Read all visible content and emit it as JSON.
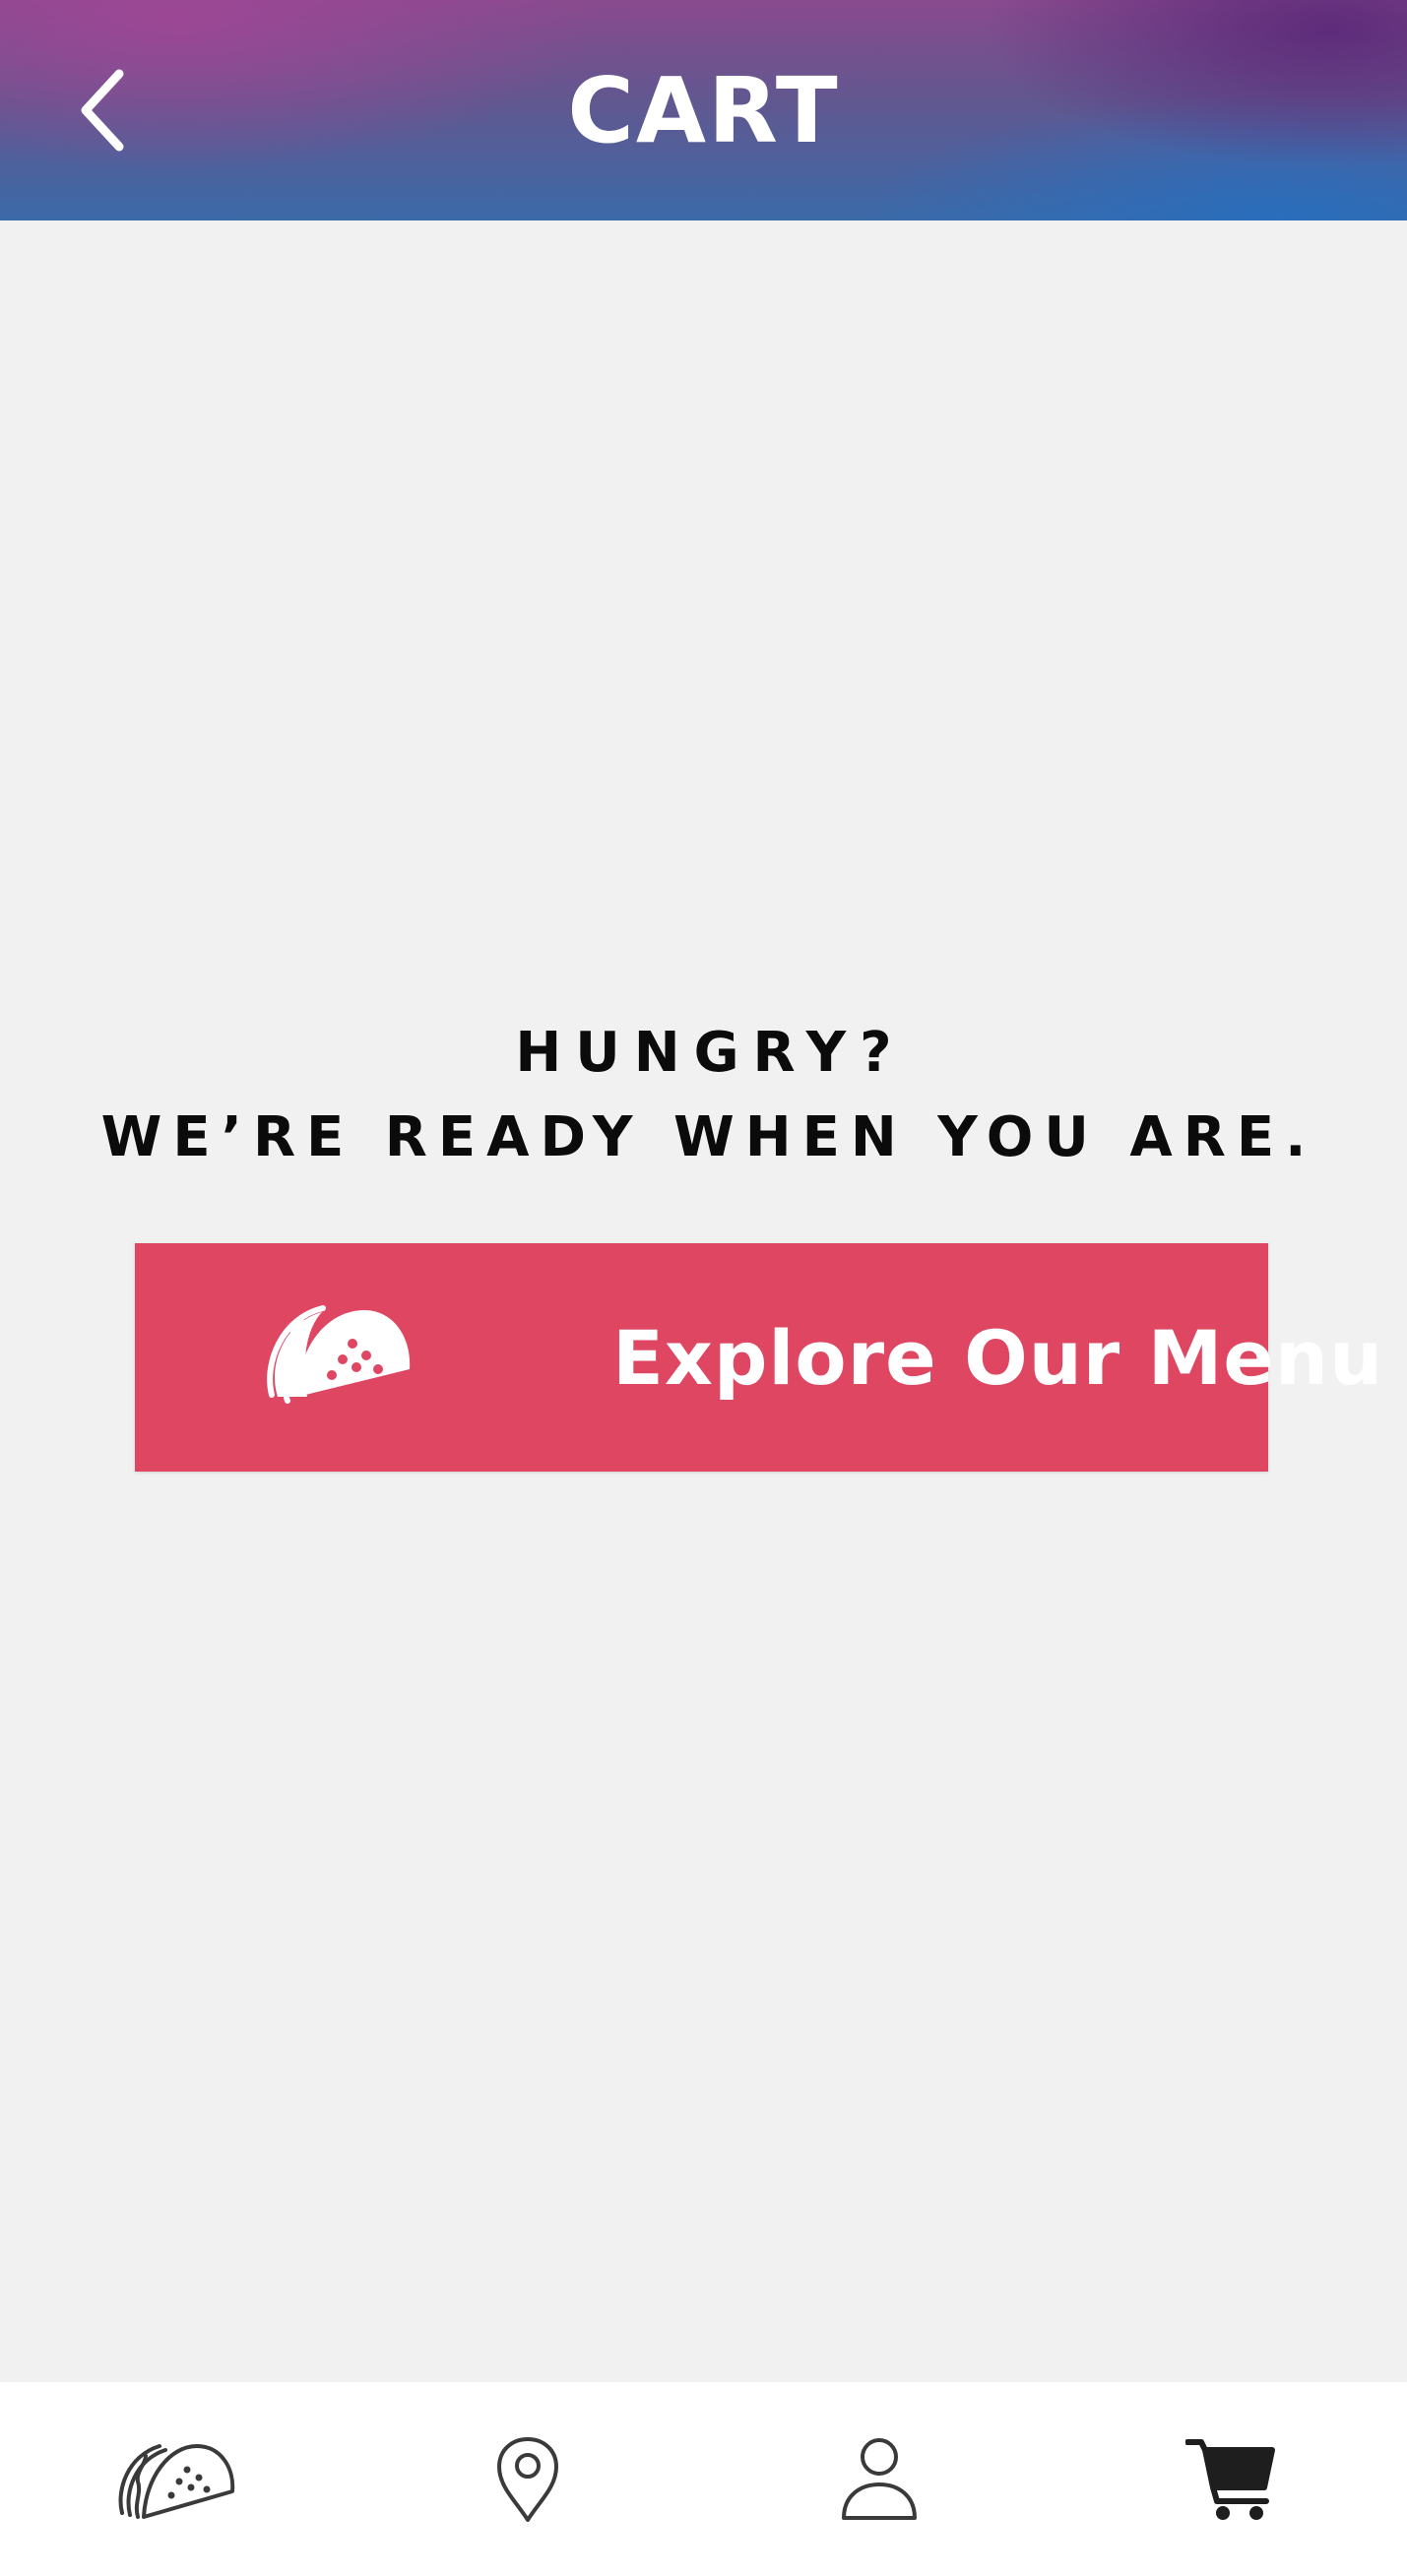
{
  "header": {
    "title": "CART",
    "back_icon": "chevron-left-icon"
  },
  "empty_state": {
    "line1": "HUNGRY?",
    "line2": "WE’RE READY WHEN YOU ARE.",
    "cta": {
      "label": "Explore Our Menu",
      "icon": "taco-icon",
      "color": "#de4662"
    }
  },
  "bottom_nav": {
    "items": [
      {
        "icon": "taco-icon",
        "id": "menu"
      },
      {
        "icon": "location-pin-icon",
        "id": "locations"
      },
      {
        "icon": "user-icon",
        "id": "account"
      },
      {
        "icon": "cart-icon",
        "id": "cart",
        "active": true
      }
    ]
  },
  "colors": {
    "header_gradient_start": "#8a4a8e",
    "header_gradient_end": "#3b6aa8",
    "background": "#f1f1f1",
    "accent": "#de4662"
  }
}
